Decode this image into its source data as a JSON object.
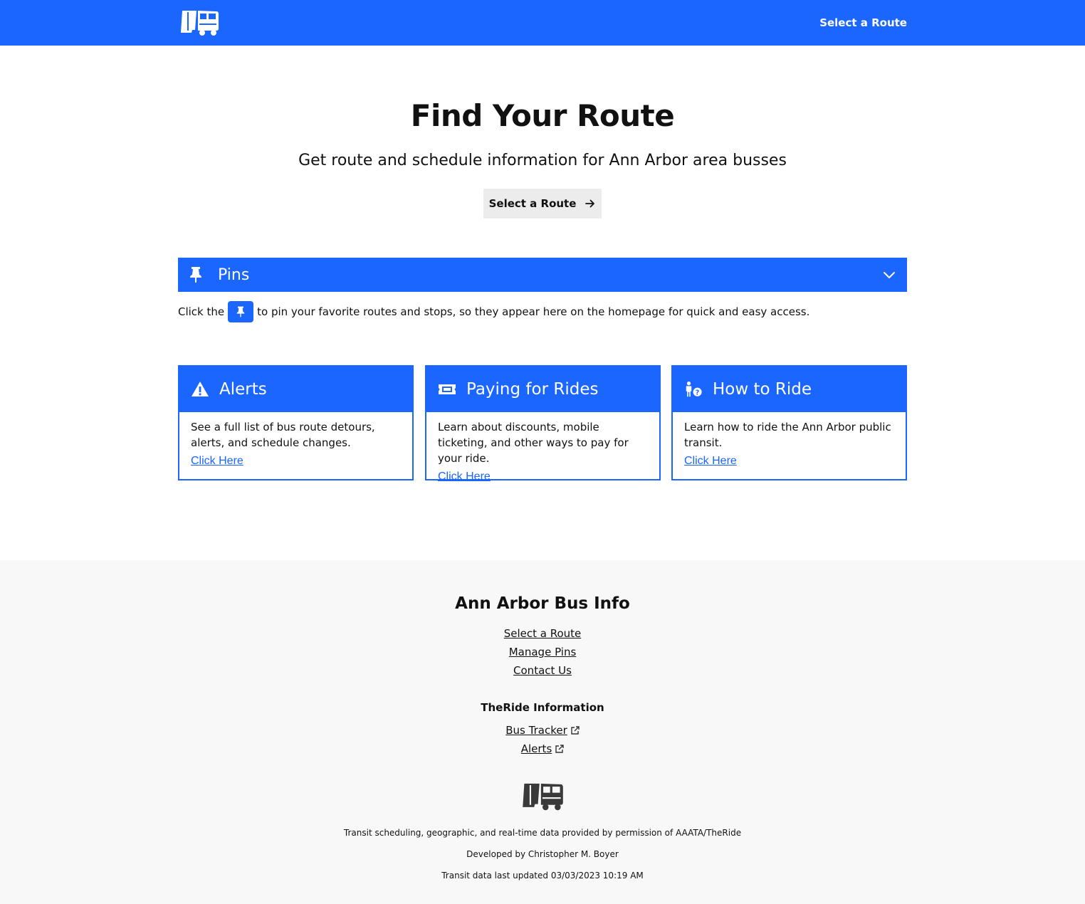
{
  "nav": {
    "logo_icon": "bus-logo-icon",
    "select_route": "Select a Route"
  },
  "hero": {
    "title": "Find Your Route",
    "subtitle": "Get route and schedule information for Ann Arbor area busses",
    "button_label": "Select a Route",
    "button_icon": "arrow-right-icon"
  },
  "pins": {
    "title": "Pins",
    "icon": "thumbtack-icon",
    "toggle_icon": "chevron-down-icon",
    "help_before": "Click the",
    "help_after": "to pin your favorite routes and stops, so they appear here on the homepage for quick and easy access."
  },
  "cards": [
    {
      "title": "Alerts",
      "icon": "warning-triangle-icon",
      "text": "See a full list of bus route detours, alerts, and schedule changes.",
      "link": "Click Here"
    },
    {
      "title": "Paying for Rides",
      "icon": "ticket-icon",
      "text": "Learn about discounts, mobile ticketing, and other ways to pay for your ride.",
      "link": "Click Here"
    },
    {
      "title": "How to Ride",
      "icon": "person-question-icon",
      "text": "Learn how to ride the Ann Arbor public transit.",
      "link": "Click Here"
    }
  ],
  "footer": {
    "title": "Ann Arbor Bus Info",
    "links": [
      "Select a Route",
      "Manage Pins",
      "Contact Us"
    ],
    "subtitle": "TheRide Information",
    "external_links": [
      "Bus Tracker",
      "Alerts"
    ],
    "external_icon": "external-link-icon",
    "logo_icon": "bus-logo-icon",
    "notes": [
      "Transit scheduling, geographic, and real-time data provided by permission of AAATA/TheRide",
      "Developed by Christopher M. Boyer",
      "Transit data last updated 03/03/2023 10:19 AM"
    ]
  },
  "colors": {
    "brand_blue": "#1a66ff",
    "footer_bg": "#f8f8f8",
    "button_bg": "#ececec"
  }
}
